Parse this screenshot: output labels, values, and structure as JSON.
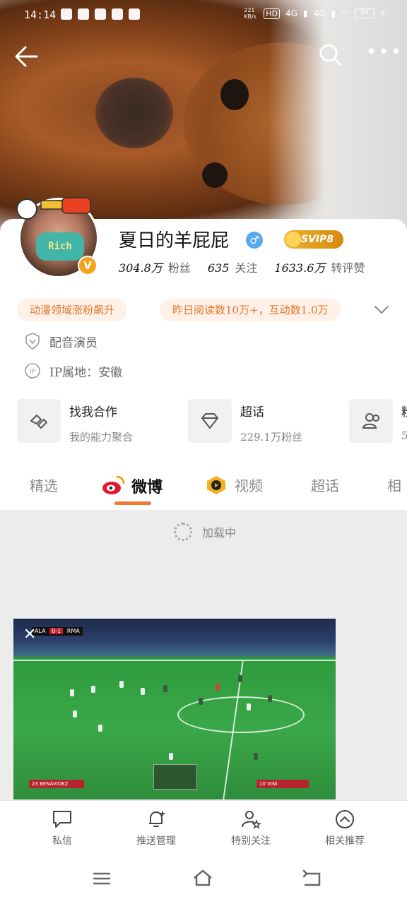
{
  "status_bar": {
    "time": "14:14",
    "speed": "221 KB/s",
    "network1": "4G",
    "network2": "4G",
    "battery": "29"
  },
  "profile": {
    "name": "夏日的羊屁屁",
    "svip": "SVIP8",
    "avatar_mask_text": "Rich",
    "stats": [
      {
        "num": "304.8万",
        "label": "粉丝"
      },
      {
        "num": "635",
        "label": "关注"
      },
      {
        "num": "1633.6万",
        "label": "转评赞"
      }
    ],
    "tags": [
      "动漫领域涨粉飙升",
      "昨日阅读数10万+，互动数1.0万"
    ],
    "info": [
      "配音演员",
      "IP属地：安徽"
    ]
  },
  "services": [
    {
      "title": "找我合作",
      "sub": "我的能力聚合"
    },
    {
      "title": "超话",
      "sub": "229.1万粉丝"
    },
    {
      "title": "粉",
      "sub": "5"
    }
  ],
  "tabs": [
    "精选",
    "微博",
    "视频",
    "超话",
    "相"
  ],
  "active_tab": "微博",
  "loading_text": "加载中",
  "video": {
    "home_team": "ALA",
    "score": "0-1",
    "away_team": "RMA",
    "left_player": "23 BENAVIDEZ",
    "right_player": "10 VINI"
  },
  "actions": [
    "私信",
    "推送管理",
    "特别关注",
    "相关推荐"
  ]
}
